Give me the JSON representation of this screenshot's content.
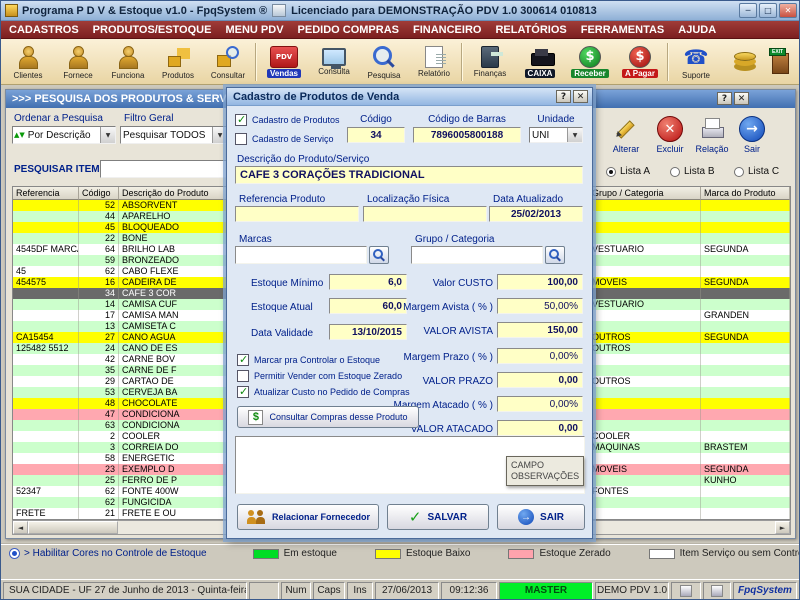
{
  "colors": {
    "menubar": "#8c2426",
    "row_ok": "#ccffcc",
    "row_low": "#ffff00",
    "row_zero": "#ffa8b0",
    "status_master_bg": "#00ef28"
  },
  "titlebar": {
    "title": "Programa P D V & Estoque v1.0 - FpqSystem ®",
    "license": "Licenciado para  DEMONSTRAÇÃO PDV 1.0 300614 010813",
    "minimize": "─",
    "maximize": "□",
    "close": "✕"
  },
  "menu": {
    "items": [
      "CADASTROS",
      "PRODUTOS/ESTOQUE",
      "MENU PDV",
      "PEDIDO COMPRAS",
      "FINANCEIRO",
      "RELATÓRIOS",
      "FERRAMENTAS",
      "AJUDA"
    ]
  },
  "toolbar": {
    "groups": [
      [
        {
          "label": "Clientes",
          "icon": "person"
        },
        {
          "label": "Fornece",
          "icon": "person"
        },
        {
          "label": "Funciona",
          "icon": "person"
        },
        {
          "label": "Produtos",
          "icon": "boxes"
        },
        {
          "label": "Consultar",
          "icon": "box-search"
        }
      ],
      [
        {
          "label": "Vendas",
          "icon": "pdv",
          "icon_text": "PDV",
          "chip": "#2038b8"
        },
        {
          "label": "Consulta",
          "icon": "monitor"
        },
        {
          "label": "Pesquisa",
          "icon": "mag-lg"
        },
        {
          "label": "Relatório",
          "icon": "report"
        }
      ],
      [
        {
          "label": "Finanças",
          "icon": "calculator"
        },
        {
          "label": "CAIXA",
          "icon": "register-dark",
          "chip": "#101828"
        },
        {
          "label": "Receber",
          "icon": "dollar-green",
          "chip": "#18862c"
        },
        {
          "label": "A Pagar",
          "icon": "dollar-red",
          "chip": "#c41818"
        }
      ],
      [
        {
          "label": "Suporte",
          "icon": "phone"
        }
      ]
    ],
    "trailing": [
      {
        "icon": "coins",
        "name": "coins",
        "sign": ""
      },
      {
        "icon": "exit",
        "name": "exit",
        "sign": "EXIT"
      }
    ]
  },
  "search_window": {
    "title": ">>>  PESQUISA DOS PRODUTOS & SERVIÇOS",
    "help_btn": "?",
    "close_btn": "✕",
    "order_label": "Ordenar a Pesquisa",
    "filter_label": "Filtro Geral",
    "order_value": "Por Descrição",
    "filter_value": "Pesquisar TODOS",
    "search_label": "PESQUISAR ITEM",
    "search_value": "",
    "actions": [
      {
        "label": "Alterar",
        "icon": "pencil"
      },
      {
        "label": "Excluir",
        "icon": "redx"
      },
      {
        "label": "Relação",
        "icon": "printer"
      },
      {
        "label": "Sair",
        "icon": "bluearrow"
      }
    ],
    "lists": [
      {
        "label": "Lista A",
        "selected": true
      },
      {
        "label": "Lista B",
        "selected": false
      },
      {
        "label": "Lista C",
        "selected": false
      }
    ],
    "table": {
      "columns": [
        "Referencia",
        "Código",
        "Descrição do Produto",
        "Grupo / Categoria",
        "Marca do Produto"
      ],
      "rows": [
        {
          "ref": "",
          "cod": "52",
          "desc": "ABSORVENT",
          "grupo": "",
          "marca": "",
          "status": "low"
        },
        {
          "ref": "",
          "cod": "44",
          "desc": "APARELHO",
          "grupo": "",
          "marca": "",
          "status": "ok-a"
        },
        {
          "ref": "",
          "cod": "45",
          "desc": "BLOQUEADO",
          "grupo": "",
          "marca": "",
          "status": "low"
        },
        {
          "ref": "",
          "cod": "22",
          "desc": "BONE",
          "grupo": "",
          "marca": "",
          "status": "ok-a"
        },
        {
          "ref": "4545DF MARCA",
          "cod": "64",
          "desc": "BRILHO LAB",
          "grupo": "VESTUARIO",
          "marca": "SEGUNDA",
          "status": "ok-b"
        },
        {
          "ref": "",
          "cod": "59",
          "desc": "BRONZEADO",
          "grupo": "",
          "marca": "",
          "status": "ok-a"
        },
        {
          "ref": "45",
          "cod": "62",
          "desc": "CABO FLEXE",
          "grupo": "",
          "marca": "",
          "status": "ok-b"
        },
        {
          "ref": "454575",
          "cod": "16",
          "desc": "CADEIRA DE",
          "grupo": "MOVEIS",
          "marca": "SEGUNDA",
          "status": "low"
        },
        {
          "ref": "",
          "cod": "34",
          "desc": "CAFE 3 COR",
          "grupo": "",
          "marca": "",
          "status": "selected"
        },
        {
          "ref": "",
          "cod": "14",
          "desc": "CAMISA CUF",
          "grupo": "VESTUARIO",
          "marca": "",
          "status": "ok-a"
        },
        {
          "ref": "",
          "cod": "17",
          "desc": "CAMISA MAN",
          "grupo": "",
          "marca": "GRANDEN",
          "status": "ok-b"
        },
        {
          "ref": "",
          "cod": "13",
          "desc": "CAMISETA C",
          "grupo": "",
          "marca": "",
          "status": "ok-a"
        },
        {
          "ref": "CA15454",
          "cod": "27",
          "desc": "CANO AGUA",
          "grupo": "OUTROS",
          "marca": "SEGUNDA",
          "status": "low"
        },
        {
          "ref": "125482 5512",
          "cod": "24",
          "desc": "CANO DE ES",
          "grupo": "OUTROS",
          "marca": "",
          "status": "ok-a"
        },
        {
          "ref": "",
          "cod": "42",
          "desc": "CARNE BOV",
          "grupo": "",
          "marca": "",
          "status": "ok-b"
        },
        {
          "ref": "",
          "cod": "35",
          "desc": "CARNE DE F",
          "grupo": "",
          "marca": "",
          "status": "ok-a"
        },
        {
          "ref": "",
          "cod": "29",
          "desc": "CARTAO DE",
          "grupo": "OUTROS",
          "marca": "",
          "status": "ok-b"
        },
        {
          "ref": "",
          "cod": "53",
          "desc": "CERVEJA BA",
          "grupo": "",
          "marca": "",
          "status": "ok-a"
        },
        {
          "ref": "",
          "cod": "48",
          "desc": "CHOCOLATE",
          "grupo": "",
          "marca": "",
          "status": "low"
        },
        {
          "ref": "",
          "cod": "47",
          "desc": "CONDICIONA",
          "grupo": "",
          "marca": "",
          "status": "zero"
        },
        {
          "ref": "",
          "cod": "63",
          "desc": "CONDICIONA",
          "grupo": "",
          "marca": "",
          "status": "ok-a"
        },
        {
          "ref": "",
          "cod": "2",
          "desc": "COOLER",
          "grupo": "COOLER",
          "marca": "",
          "status": "ok-b"
        },
        {
          "ref": "",
          "cod": "3",
          "desc": "CORREIA DO",
          "grupo": "MAQUINAS",
          "marca": "BRASTEM",
          "status": "ok-a"
        },
        {
          "ref": "",
          "cod": "58",
          "desc": "ENERGETIC",
          "grupo": "",
          "marca": "",
          "status": "ok-b"
        },
        {
          "ref": "",
          "cod": "23",
          "desc": "EXEMPLO D",
          "grupo": "MOVEIS",
          "marca": "SEGUNDA",
          "status": "zero"
        },
        {
          "ref": "",
          "cod": "25",
          "desc": "FERRO DE P",
          "grupo": "",
          "marca": "KUNHO",
          "status": "ok-a"
        },
        {
          "ref": "52347",
          "cod": "62",
          "desc": "FONTE 400W",
          "grupo": "FONTES",
          "marca": "",
          "status": "ok-b"
        },
        {
          "ref": "",
          "cod": "62",
          "desc": "FUNGICIDA",
          "grupo": "",
          "marca": "",
          "status": "ok-a"
        },
        {
          "ref": "FRETE",
          "cod": "21",
          "desc": "FRETE E OU",
          "grupo": "",
          "marca": "",
          "status": "ok-b"
        }
      ]
    }
  },
  "modal": {
    "title": "Cadastro de Produtos de Venda",
    "help_btn": "?",
    "close_btn": "✕",
    "chk_produtos": "Cadastro de Produtos",
    "chk_servico": "Cadastro de Serviço",
    "codigo_label": "Código",
    "codigo": "34",
    "barras_label": "Código de Barras",
    "barras": "7896005800188",
    "unidade_label": "Unidade",
    "unidade": "UNI",
    "descricao_label": "Descrição do Produto/Serviço",
    "descricao": "CAFE 3 CORAÇÕES TRADICIONAL",
    "ref_label": "Referencia Produto",
    "ref": "",
    "loc_label": "Localização Física",
    "loc": "",
    "atualizado_label": "Data Atualizado",
    "atualizado": "25/02/2013",
    "marcas_label": "Marcas",
    "marcas": "",
    "grupo_label": "Grupo / Categoria",
    "grupo": "",
    "estoque_min_label": "Estoque Mínimo",
    "estoque_min": "6,0",
    "estoque_atual_label": "Estoque Atual",
    "estoque_atual": "60,0",
    "validade_label": "Data Validade",
    "validade": "13/10/2015",
    "custo_label": "Valor CUSTO",
    "custo": "100,00",
    "margem_avista_label": "Margem Avista ( % )",
    "margem_avista": "50,00%",
    "valor_avista_label": "VALOR AVISTA",
    "valor_avista": "150,00",
    "margem_prazo_label": "Margem Prazo ( % )",
    "margem_prazo": "0,00%",
    "valor_prazo_label": "VALOR PRAZO",
    "valor_prazo": "0,00",
    "margem_atacado_label": "Margem Atacado ( % )",
    "margem_atacado": "0,00%",
    "valor_atacado_label": "VALOR ATACADO",
    "valor_atacado": "0,00",
    "chk_controlar": "Marcar pra Controlar o Estoque",
    "chk_vender_zerado": "Permitir Vender com Estoque Zerado",
    "chk_atualizar_custo": "Atualizar Custo no Pedido de Compras",
    "btn_consultar_compras": "Consultar Compras desse Produto",
    "observacoes": "",
    "btn_fornecedor": "Relacionar Fornecedor",
    "btn_salvar": "SALVAR",
    "btn_sair": "SAIR"
  },
  "tooltip": {
    "lines": [
      "CAMPO",
      "OBSERVAÇÕES"
    ]
  },
  "legend": {
    "toggle_label": "> Habilitar Cores no Controle de Estoque",
    "items": [
      {
        "label": "Em estoque",
        "color": "#00dd26"
      },
      {
        "label": "Estoque Baixo",
        "color": "#ffff00"
      },
      {
        "label": "Estoque Zerado",
        "color": "#ffa3ad"
      },
      {
        "label": "Item Serviço ou sem Controle de Estoque",
        "color": "#ffffff"
      }
    ]
  },
  "statusbar": {
    "location": "SUA CIDADE - UF 27 de Junho de 2013 - Quinta-feira",
    "num": "Num",
    "caps": "Caps",
    "ins": "Ins",
    "date": "27/06/2013",
    "time": "09:12:36",
    "user": "MASTER",
    "version": "DEMO PDV 1.0",
    "brand": "FpqSystem"
  }
}
